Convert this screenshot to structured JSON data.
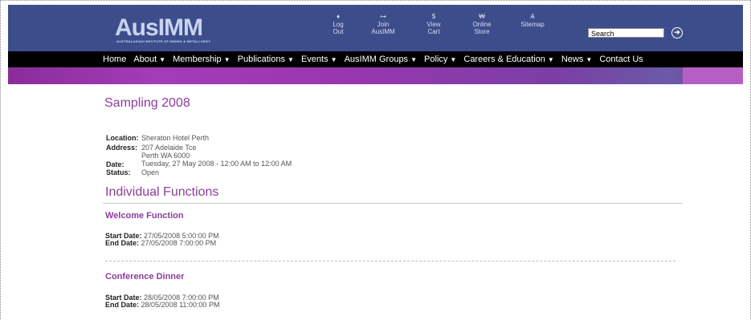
{
  "header": {
    "logo_text_a": "Aus",
    "logo_text_b": "IMM",
    "logo_sub": "Australasian Institute of Mining & Metallurgy",
    "links": [
      {
        "icon": "♦",
        "line1": "Log",
        "line2": "Out",
        "name": "log-out-icon"
      },
      {
        "icon": "⊶",
        "line1": "Join",
        "line2": "AusIMM",
        "name": "join-icon"
      },
      {
        "icon": "$",
        "line1": "View",
        "line2": "Cart",
        "name": "cart-icon"
      },
      {
        "icon": "₩",
        "line1": "Online",
        "line2": "Store",
        "name": "store-icon"
      },
      {
        "icon": "Ѧ",
        "line1": "Sitemap",
        "line2": "",
        "name": "sitemap-icon"
      }
    ],
    "search_value": "Search",
    "go_glyph": "➔"
  },
  "nav": [
    {
      "label": "Home",
      "caret": ""
    },
    {
      "label": "About",
      "caret": "▼"
    },
    {
      "label": "Membership",
      "caret": "▼"
    },
    {
      "label": "Publications",
      "caret": "▼"
    },
    {
      "label": "Events",
      "caret": "▼"
    },
    {
      "label": "AusIMM Groups",
      "caret": "▼"
    },
    {
      "label": "Policy",
      "caret": "▼"
    },
    {
      "label": "Careers & Education",
      "caret": "▼"
    },
    {
      "label": "News",
      "caret": "▼"
    },
    {
      "label": "Contact Us",
      "caret": ""
    }
  ],
  "event": {
    "title": "Sampling 2008",
    "location_label": "Location:",
    "location_value": "Sheraton Hotel Perth",
    "address_label": "Address:",
    "address_line1": "207 Adelaide Tce",
    "address_line2": "Perth WA 6000",
    "date_label": "Date:",
    "date_value": "Tuesday, 27 May 2008 - 12:00 AM to 12:00 AM",
    "status_label": "Status:",
    "status_value": "Open"
  },
  "functions": {
    "section_title": "Individual Functions",
    "items": [
      {
        "title": "Welcome Function",
        "start_label": "Start Date:",
        "start_value": "27/05/2008 5:00:00 PM",
        "end_label": "End Date:",
        "end_value": "27/05/2008 7:00:00 PM"
      },
      {
        "title": "Conference Dinner",
        "start_label": "Start Date:",
        "start_value": "28/05/2008 7:00:00 PM",
        "end_label": "End Date:",
        "end_value": "28/05/2008 11:00:00 PM"
      }
    ]
  }
}
